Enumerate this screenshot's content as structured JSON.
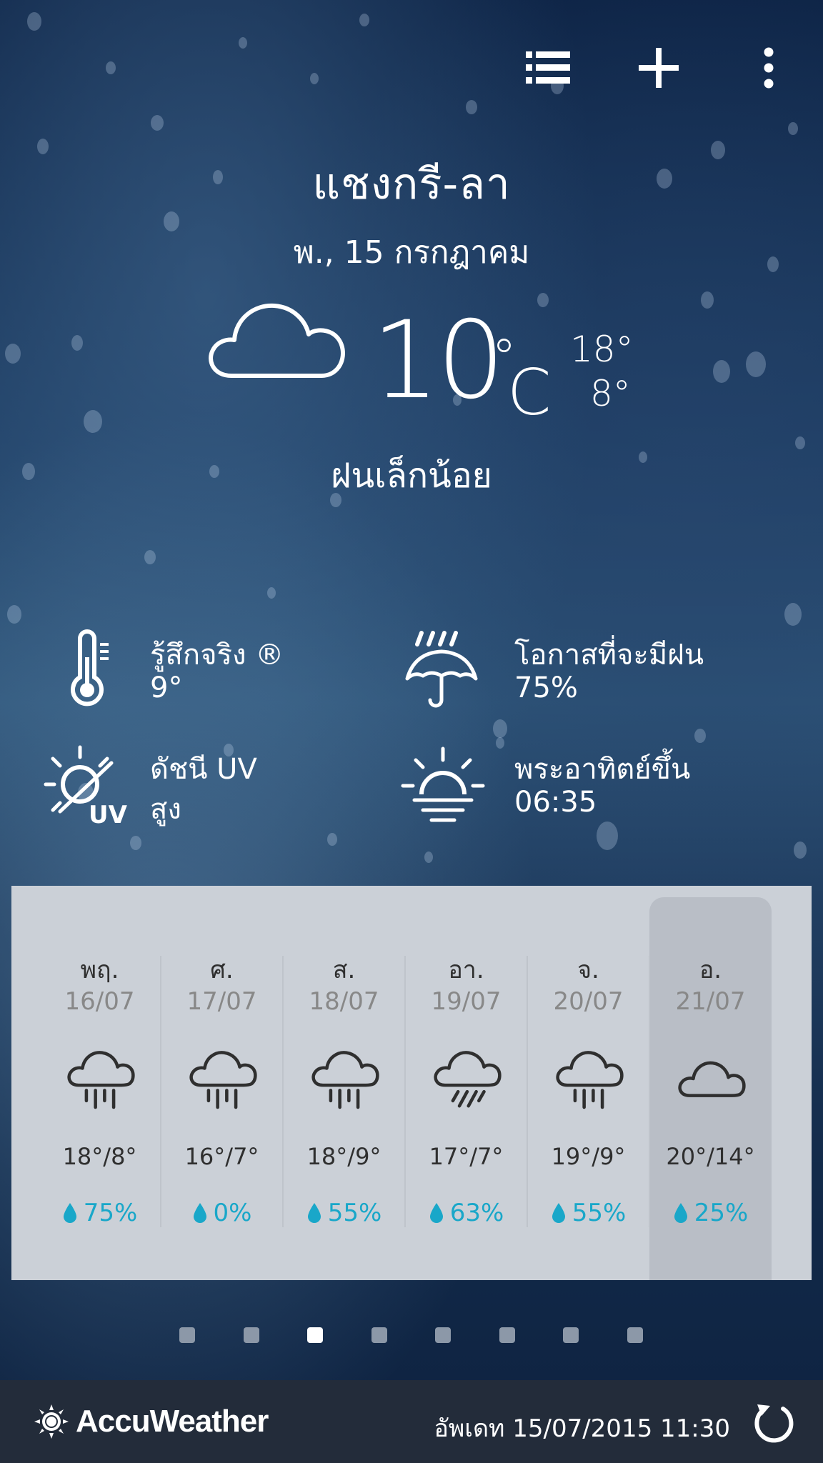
{
  "toolbar": {
    "icons": [
      "list-icon",
      "add-icon",
      "more-icon"
    ]
  },
  "location": {
    "city": "แชงกรี-ลา",
    "date": "พ., 15 กรกฎาคม"
  },
  "current": {
    "icon": "cloud-icon",
    "temp": "10",
    "degree": "°",
    "unit": "C",
    "high": "18°",
    "low": "8°",
    "condition": "ฝนเล็กน้อย"
  },
  "details": {
    "feels_like": {
      "icon": "thermometer-icon",
      "label": "รู้สึกจริง ®",
      "value": "9°"
    },
    "rain_chance": {
      "icon": "umbrella-rain-icon",
      "label": "โอกาสที่จะมีฝน",
      "value": "75%"
    },
    "uv_index": {
      "icon": "uv-sun-icon",
      "label": "ดัชนี UV",
      "value": "สูง"
    },
    "sunrise": {
      "icon": "sunrise-icon",
      "label": "พระอาทิตย์ขึ้น",
      "value": "06:35"
    }
  },
  "forecast": [
    {
      "day": "พฤ.",
      "date": "16/07",
      "icon": "rain-cloud-icon",
      "temp": "18°/8°",
      "rain": "75%"
    },
    {
      "day": "ศ.",
      "date": "17/07",
      "icon": "rain-cloud-icon",
      "temp": "16°/7°",
      "rain": "0%"
    },
    {
      "day": "ส.",
      "date": "18/07",
      "icon": "rain-cloud-icon",
      "temp": "18°/9°",
      "rain": "55%"
    },
    {
      "day": "อา.",
      "date": "19/07",
      "icon": "slanted-rain-cloud-icon",
      "temp": "17°/7°",
      "rain": "63%"
    },
    {
      "day": "จ.",
      "date": "20/07",
      "icon": "rain-cloud-icon",
      "temp": "19°/9°",
      "rain": "55%"
    },
    {
      "day": "อ.",
      "date": "21/07",
      "icon": "cloud-icon",
      "temp": "20°/14°",
      "rain": "25%"
    }
  ],
  "pager": {
    "count": 8,
    "active_index": 2
  },
  "footer": {
    "brand": "AccuWeather",
    "updated": "อัพเดท 15/07/2015 11:30",
    "refresh_icon": "refresh-icon"
  },
  "colors": {
    "rain_accent": "#19a7c9",
    "panel_bg": "#cbd0d7",
    "footer_bg": "#232c3a"
  }
}
